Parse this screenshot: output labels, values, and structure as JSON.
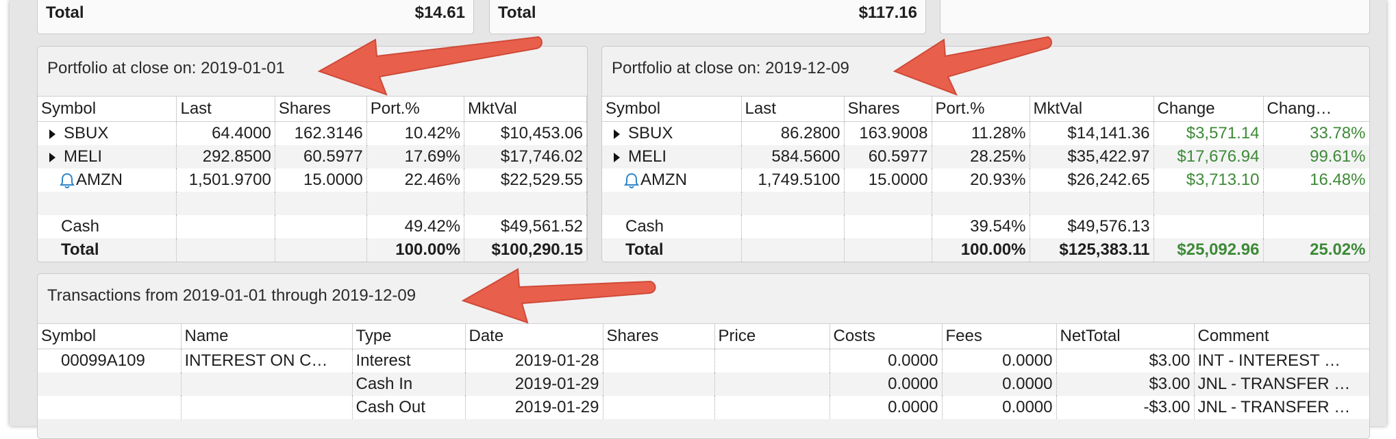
{
  "top_cards": [
    {
      "label": "Total",
      "value": "$14.61"
    },
    {
      "label": "Total",
      "value": "$117.16"
    }
  ],
  "portfolio_left": {
    "title": "Portfolio at close on: 2019-01-01",
    "columns": [
      "Symbol",
      "Last",
      "Shares",
      "Port.%",
      "MktVal"
    ],
    "rows": [
      {
        "symbol": "SBUX",
        "last": "64.4000",
        "shares": "162.3146",
        "port": "10.42%",
        "mktval": "$10,453.06"
      },
      {
        "symbol": "MELI",
        "last": "292.8500",
        "shares": "60.5977",
        "port": "17.69%",
        "mktval": "$17,746.02"
      },
      {
        "symbol": "AMZN",
        "last": "1,501.9700",
        "shares": "15.0000",
        "port": "22.46%",
        "mktval": "$22,529.55"
      }
    ],
    "cash": {
      "label": "Cash",
      "port": "49.42%",
      "mktval": "$49,561.52"
    },
    "total": {
      "label": "Total",
      "port": "100.00%",
      "mktval": "$100,290.15"
    }
  },
  "portfolio_right": {
    "title": "Portfolio at close on: 2019-12-09",
    "columns": [
      "Symbol",
      "Last",
      "Shares",
      "Port.%",
      "MktVal",
      "Change",
      "Chang…"
    ],
    "rows": [
      {
        "symbol": "SBUX",
        "last": "86.2800",
        "shares": "163.9008",
        "port": "11.28%",
        "mktval": "$14,141.36",
        "change": "$3,571.14",
        "changepct": "33.78%"
      },
      {
        "symbol": "MELI",
        "last": "584.5600",
        "shares": "60.5977",
        "port": "28.25%",
        "mktval": "$35,422.97",
        "change": "$17,676.94",
        "changepct": "99.61%"
      },
      {
        "symbol": "AMZN",
        "last": "1,749.5100",
        "shares": "15.0000",
        "port": "20.93%",
        "mktval": "$26,242.65",
        "change": "$3,713.10",
        "changepct": "16.48%"
      }
    ],
    "cash": {
      "label": "Cash",
      "port": "39.54%",
      "mktval": "$49,576.13"
    },
    "total": {
      "label": "Total",
      "port": "100.00%",
      "mktval": "$125,383.11",
      "change": "$25,092.96",
      "changepct": "25.02%"
    }
  },
  "transactions": {
    "title": "Transactions from 2019-01-01 through 2019-12-09",
    "columns": [
      "Symbol",
      "Name",
      "Type",
      "Date",
      "Shares",
      "Price",
      "Costs",
      "Fees",
      "NetTotal",
      "Comment"
    ],
    "rows": [
      {
        "symbol": "00099A109",
        "name": "INTEREST ON C…",
        "type": "Interest",
        "date": "2019-01-28",
        "shares": "",
        "price": "",
        "costs": "0.0000",
        "fees": "0.0000",
        "nettotal": "$3.00",
        "comment": "INT - INTEREST …"
      },
      {
        "symbol": "",
        "name": "",
        "type": "Cash In",
        "date": "2019-01-29",
        "shares": "",
        "price": "",
        "costs": "0.0000",
        "fees": "0.0000",
        "nettotal": "$3.00",
        "comment": "JNL - TRANSFER …"
      },
      {
        "symbol": "",
        "name": "",
        "type": "Cash Out",
        "date": "2019-01-29",
        "shares": "",
        "price": "",
        "costs": "0.0000",
        "fees": "0.0000",
        "nettotal": "-$3.00",
        "comment": "JNL - TRANSFER …"
      }
    ]
  },
  "icons": {
    "expand": "triangle-right-icon",
    "alert": "bell-icon",
    "annotation": "red-arrow"
  },
  "colors": {
    "positive": "#3d8a36",
    "arrow": "#e8604c",
    "bell": "#2f86c9"
  }
}
